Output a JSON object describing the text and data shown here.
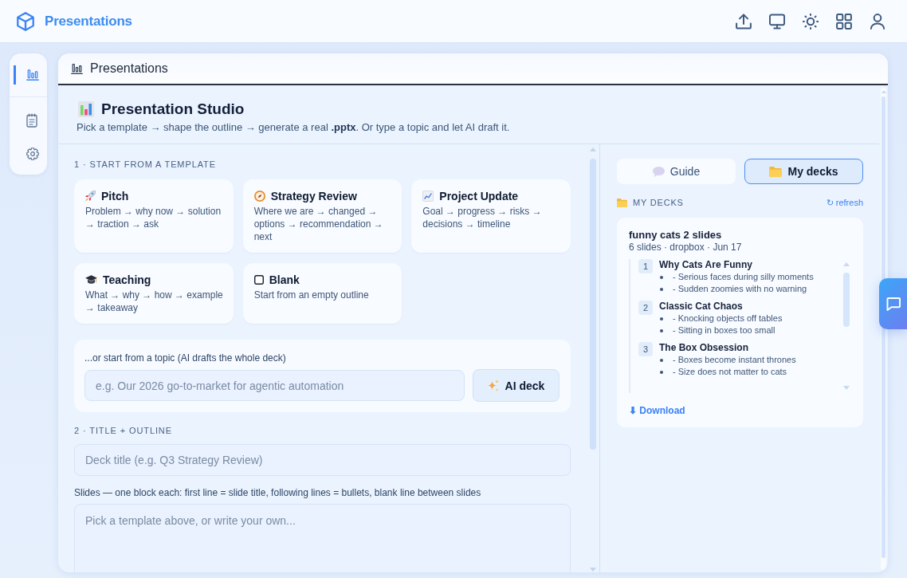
{
  "header": {
    "brand": "Presentations"
  },
  "sidebar": {
    "items": [
      {
        "kind": "chart",
        "selected": true
      },
      {
        "kind": "notes",
        "selected": false
      },
      {
        "kind": "settings",
        "selected": false
      }
    ]
  },
  "panel": {
    "title": "Presentations"
  },
  "studio": {
    "title": "Presentation Studio",
    "subtitle": "Pick a template → shape the outline → generate a real **.pptx**. Or type a topic and let AI draft it."
  },
  "templates": {
    "heading": "1 · START FROM A TEMPLATE",
    "cards": [
      {
        "kind": "rocket",
        "title": "Pitch",
        "description": "Problem → why now → solution → traction → ask"
      },
      {
        "kind": "compass",
        "title": "Strategy Review",
        "description": "Where we are → changed → options → recommendation → next"
      },
      {
        "kind": "trend",
        "title": "Project Update",
        "description": "Goal → progress → risks → decisions → timeline"
      },
      {
        "kind": "cap",
        "title": "Teaching",
        "description": "What → why → how → example → takeaway"
      },
      {
        "kind": "blank",
        "title": "Blank",
        "description": "Start from an empty outline"
      }
    ]
  },
  "topic": {
    "label": "...or start from a topic (AI drafts the whole deck)",
    "field": {
      "placeholder": "e.g. Our 2026 go-to-market for agentic automation"
    },
    "button": "AI deck"
  },
  "outline": {
    "heading": "2 · TITLE + OUTLINE",
    "title_field": {
      "placeholder": "Deck title (e.g. Q3 Strategy Review)"
    },
    "slides_label": "Slides — one block each: first line = slide title, following lines = bullets, blank line between slides",
    "slides_field": {
      "placeholder": "Pick a template above, or write your own..."
    }
  },
  "decks_panel": {
    "tabs": [
      {
        "kind": "guide",
        "label": "Guide",
        "selected": false
      },
      {
        "kind": "folder",
        "label": "My decks",
        "selected": true
      }
    ],
    "heading": "MY DECKS",
    "refresh": "↻ refresh",
    "decks": [
      {
        "title": "funny cats 2 slides",
        "meta": "6 slides · dropbox · Jun 17",
        "slides": [
          {
            "number": "1",
            "title": "Why Cats Are Funny",
            "bullets": [
              "- Serious faces during silly moments",
              "- Sudden zoomies with no warning"
            ]
          },
          {
            "number": "2",
            "title": "Classic Cat Chaos",
            "bullets": [
              "- Knocking objects off tables",
              "- Sitting in boxes too small"
            ]
          },
          {
            "number": "3",
            "title": "The Box Obsession",
            "bullets": [
              "- Boxes become instant thrones",
              "- Size does not matter to cats"
            ]
          }
        ],
        "download": "⬇ Download"
      }
    ]
  }
}
